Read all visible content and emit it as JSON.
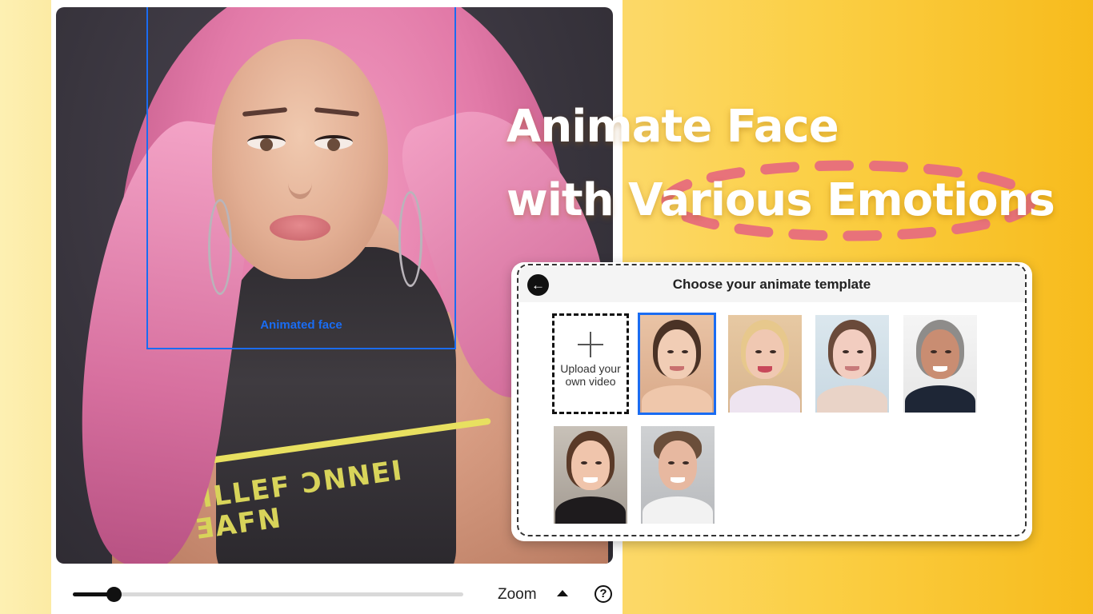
{
  "editor": {
    "detection_label": "Animated face",
    "shirt_text": "ЯLLEF ƆNNEI\nƎAFN",
    "zoom": {
      "label": "Zoom",
      "slider_value": 0.104,
      "help_symbol": "?"
    }
  },
  "headline": {
    "line1": "Animate Face",
    "line2": "with Various Emotions"
  },
  "dialog": {
    "title": "Choose your animate template",
    "back_icon": "arrow-left-icon",
    "upload": {
      "icon": "plus-icon",
      "label": "Upload your own video"
    },
    "templates": [
      {
        "id": "template-1",
        "selected": true
      },
      {
        "id": "template-2",
        "selected": false
      },
      {
        "id": "template-3",
        "selected": false
      },
      {
        "id": "template-4",
        "selected": false
      },
      {
        "id": "template-5",
        "selected": false
      },
      {
        "id": "template-6",
        "selected": false
      }
    ]
  },
  "colors": {
    "accent": "#1a6cf2",
    "headline_decoration": "#e8727a",
    "background_left": "#fdf0b2",
    "background_right": "#f7bb1c"
  }
}
